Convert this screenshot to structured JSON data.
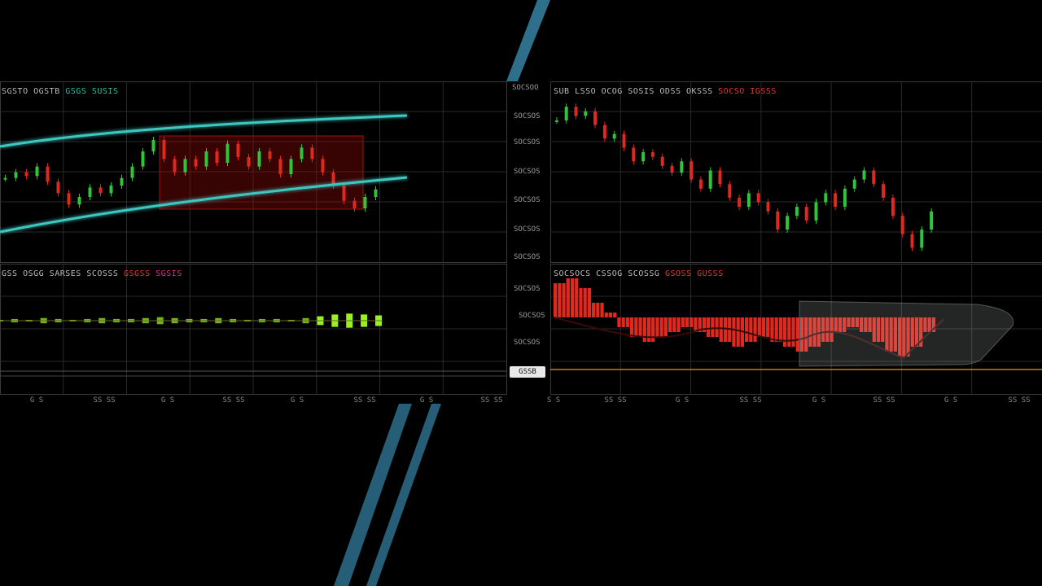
{
  "theme": {
    "bg": "#000000",
    "grid": "#2a2a2a",
    "up": "#2fc43a",
    "down": "#e0281e",
    "band": "#3cc7c0",
    "accent": "#2e6f8c",
    "osc_up": "#9cf022",
    "baseline": "#c97a1a"
  },
  "panels": {
    "top_left": {
      "label": "SGSTO OGSTB",
      "label_green": "GSGS SUSIS"
    },
    "top_right": {
      "label": "SUB LSSO OCOG SOSIS ODSS OKSSS",
      "label_red": "SOCSO IGSSS"
    },
    "bottom_left": {
      "label": "GSS OSGG SARSES SCOSSS",
      "label_red": "GSGSS",
      "label_magenta": "SGSIS"
    },
    "bottom_right": {
      "label": "SOCSOCS CSSOG SCOSSG",
      "label_red": "GSOSS GUSSS"
    }
  },
  "y_ticks_top": [
    "SOCSOO",
    "SOCSOS",
    "SOCSOS",
    "SOCSOS",
    "SOCSOS",
    "SOCSOS",
    "SOCSOS"
  ],
  "y_ticks_bottom": [
    "SOCSOS",
    "SOCSOS",
    "SOCSOS"
  ],
  "badge": "GSSB",
  "x_ticks_left": [
    "G S",
    "SS SS",
    "G S",
    "SS SS",
    "G S",
    "SS SS",
    "G S",
    "SS SS"
  ],
  "x_ticks_right": [
    "S S",
    "SS SS",
    "G S",
    "SS SS",
    "G S",
    "SS SS",
    "G S",
    "SS SS"
  ],
  "chart_data": [
    {
      "type": "candlestick",
      "panel": "top_left",
      "series": [
        {
          "values": [
            52,
            55,
            53,
            58,
            50,
            44,
            38,
            42,
            47,
            44,
            48,
            52,
            58,
            66,
            72,
            62,
            55,
            62,
            58,
            66,
            60,
            70,
            63,
            58,
            66,
            62,
            54,
            62,
            68,
            62,
            55,
            48,
            40,
            36,
            42,
            46
          ]
        }
      ],
      "annotations": [
        "upper-band",
        "lower-band",
        "red-highlight-box"
      ]
    },
    {
      "type": "candlestick",
      "panel": "top_right",
      "series": [
        {
          "values": [
            78,
            84,
            80,
            82,
            76,
            70,
            72,
            66,
            60,
            64,
            62,
            58,
            55,
            60,
            52,
            48,
            56,
            50,
            44,
            40,
            46,
            42,
            38,
            30,
            36,
            40,
            34,
            42,
            46,
            40,
            48,
            52,
            56,
            50,
            44,
            36,
            28,
            22,
            30,
            38
          ]
        }
      ]
    },
    {
      "type": "area",
      "panel": "bottom_left",
      "series": [
        {
          "values": [
            0,
            1,
            0,
            2,
            1,
            0,
            1,
            2,
            1,
            1,
            2,
            3,
            2,
            1,
            1,
            2,
            1,
            0,
            1,
            1,
            0,
            2,
            4,
            6,
            7,
            6,
            5
          ]
        }
      ]
    },
    {
      "type": "bar",
      "panel": "bottom_right",
      "series": [
        {
          "values": [
            7,
            8,
            6,
            3,
            1,
            -2,
            -4,
            -5,
            -4,
            -3,
            -2,
            -3,
            -4,
            -5,
            -6,
            -5,
            -4,
            -5,
            -6,
            -7,
            -6,
            -5,
            -3,
            -2,
            -3,
            -5,
            -7,
            -8,
            -6,
            -3
          ]
        }
      ]
    }
  ]
}
